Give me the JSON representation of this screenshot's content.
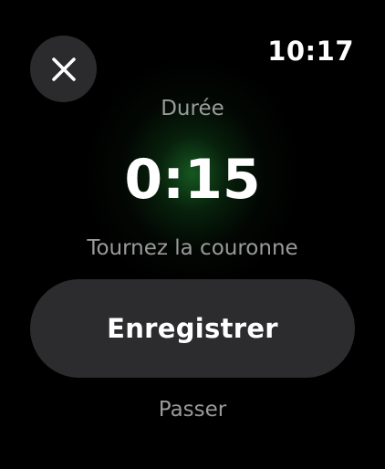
{
  "status_bar": {
    "time": "10:17"
  },
  "header": {
    "close_icon": "close-icon"
  },
  "timer": {
    "label": "Durée",
    "value": "0:15",
    "hint": "Tournez la couronne"
  },
  "actions": {
    "save_label": "Enregistrer",
    "skip_label": "Passer"
  },
  "colors": {
    "background": "#000000",
    "button": "#2c2c2e",
    "secondary_text": "#9a9a9c",
    "glow_accent": "#28a03c"
  }
}
